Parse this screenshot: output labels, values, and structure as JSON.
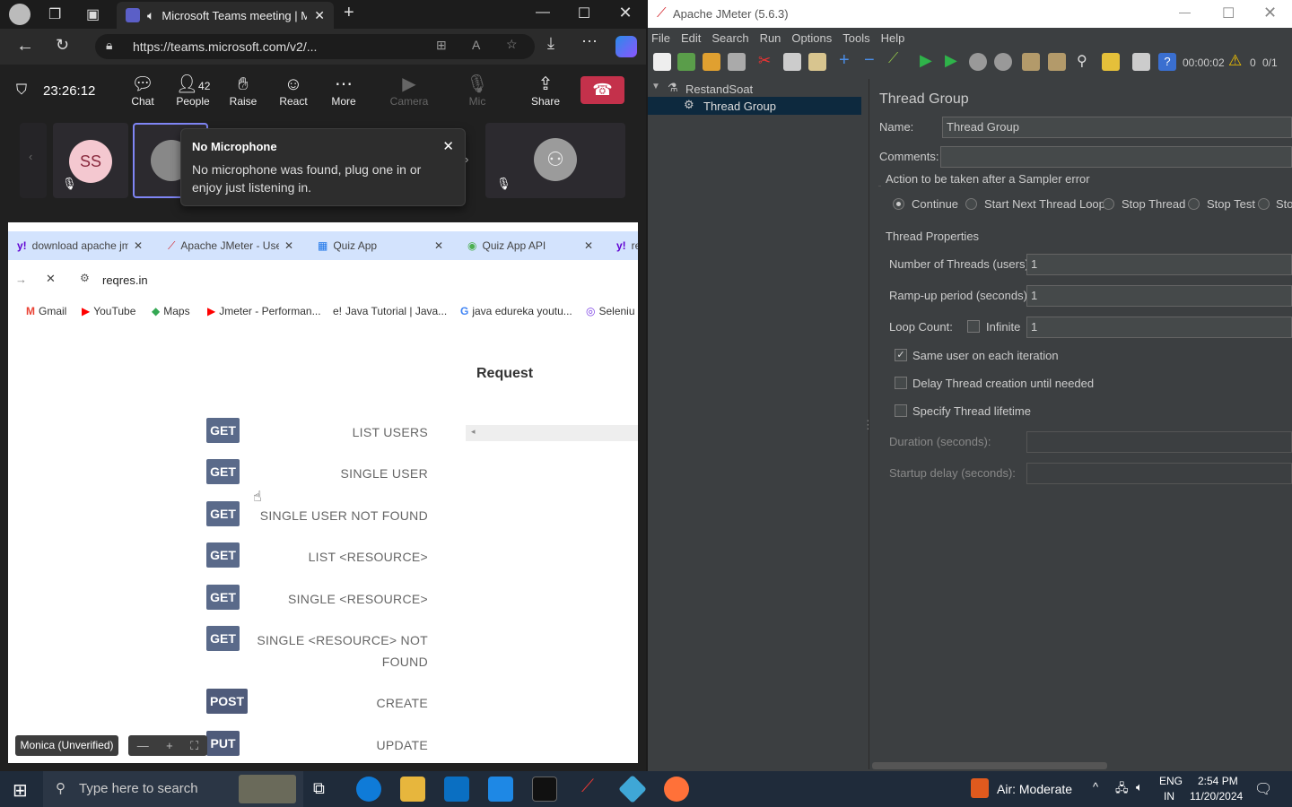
{
  "edge": {
    "tab_title": "Microsoft Teams meeting | M",
    "url": "https://teams.microsoft.com/v2/..."
  },
  "teams": {
    "clock": "23:26:12",
    "buttons": {
      "chat": "Chat",
      "people": "People",
      "people_count": "42",
      "raise": "Raise",
      "react": "React",
      "more": "More",
      "camera": "Camera",
      "mic": "Mic",
      "share": "Share"
    },
    "participant_initials": "SS",
    "tooltip_title": "No Microphone",
    "tooltip_body": "No microphone was found, plug one in or enjoy just listening in.",
    "presenter": "Monica (Unverified)"
  },
  "shared": {
    "tabs": [
      "download apache jm",
      "Apache JMeter - Use",
      "Quiz App",
      "Quiz App API",
      "re"
    ],
    "address": "reqres.in",
    "bookmarks": [
      "Gmail",
      "YouTube",
      "Maps",
      "Jmeter - Performan...",
      "Java Tutorial | Java...",
      "java edureka youtu...",
      "Seleniu"
    ],
    "request_header": "Request",
    "endpoints": [
      {
        "method": "GET",
        "label": "LIST USERS"
      },
      {
        "method": "GET",
        "label": "SINGLE USER"
      },
      {
        "method": "GET",
        "label": "SINGLE USER NOT FOUND"
      },
      {
        "method": "GET",
        "label": "LIST <RESOURCE>"
      },
      {
        "method": "GET",
        "label": "SINGLE <RESOURCE>"
      },
      {
        "method": "GET",
        "label": "SINGLE <RESOURCE> NOT",
        "label2": "FOUND"
      },
      {
        "method": "POST",
        "label": "CREATE"
      },
      {
        "method": "PUT",
        "label": "UPDATE"
      }
    ]
  },
  "jmeter": {
    "title": "Apache JMeter (5.6.3)",
    "menu": [
      "File",
      "Edit",
      "Search",
      "Run",
      "Options",
      "Tools",
      "Help"
    ],
    "timer": "00:00:02",
    "warn_count": "0",
    "threads": "0/1",
    "tree": {
      "root": "RestandSoat",
      "child": "Thread Group"
    },
    "panel_title": "Thread Group",
    "name_label": "Name:",
    "name_value": "Thread Group",
    "comments_label": "Comments:",
    "sampler_error_label": "Action to be taken after a Sampler error",
    "actions": [
      "Continue",
      "Start Next Thread Loop",
      "Stop Thread",
      "Stop Test",
      "Sto"
    ],
    "thread_props_label": "Thread Properties",
    "threads_label": "Number of Threads (users):",
    "threads_value": "1",
    "rampup_label": "Ramp-up period (seconds):",
    "rampup_value": "1",
    "loop_label": "Loop Count:",
    "infinite_label": "Infinite",
    "loop_value": "1",
    "same_user_label": "Same user on each iteration",
    "delay_label": "Delay Thread creation until needed",
    "lifetime_label": "Specify Thread lifetime",
    "duration_label": "Duration (seconds):",
    "startup_label": "Startup delay (seconds):"
  },
  "taskbar": {
    "search_placeholder": "Type here to search",
    "weather": "Air: Moderate",
    "lang1": "ENG",
    "lang2": "IN",
    "time": "2:54 PM",
    "date": "11/20/2024"
  }
}
